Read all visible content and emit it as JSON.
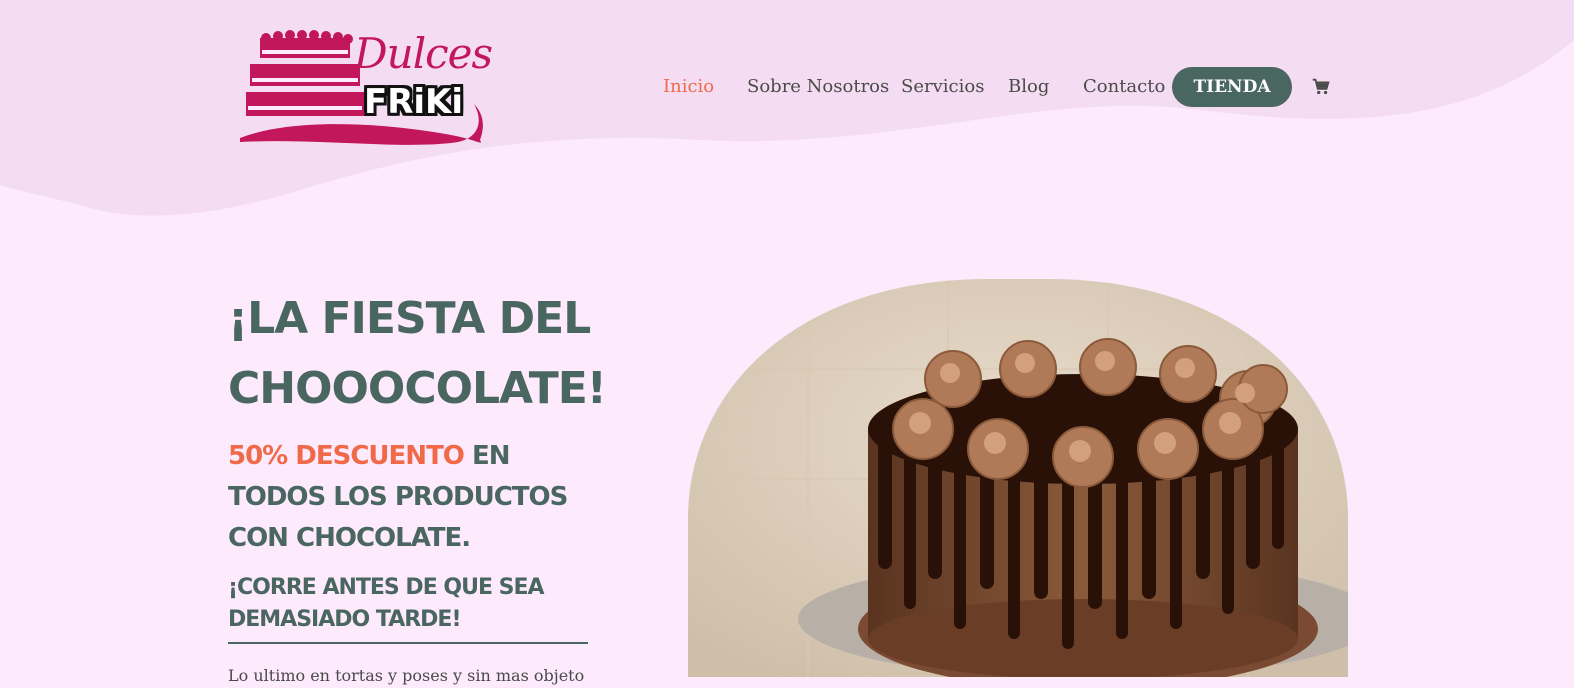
{
  "logo": {
    "line1": "Dulces",
    "line2": "FRiKi",
    "brand_color": "#c2175b"
  },
  "nav": {
    "items": [
      {
        "label": "Inicio",
        "active": true
      },
      {
        "label": "Sobre Nosotros",
        "active": false
      },
      {
        "label": "Servicios",
        "active": false
      },
      {
        "label": "Blog",
        "active": false
      },
      {
        "label": "Contacto",
        "active": false
      }
    ],
    "shop_button": "TIENDA",
    "cart_icon": "cart-icon"
  },
  "hero": {
    "title": "¡La Fiesta del Chooocolate!",
    "subtitle_accent": "50% Descuento",
    "subtitle_rest": " en todos los productos con chocolate.",
    "cta": "¡Corre antes de que sea demasiado tarde!",
    "body_partial": "Lo ultimo en tortas y poses y sin mas objeto"
  },
  "colors": {
    "background": "#fdeafd",
    "header_wave": "#f4ddf2",
    "primary": "#4a6660",
    "accent": "#f06a4a",
    "text": "#4a4a4a"
  }
}
